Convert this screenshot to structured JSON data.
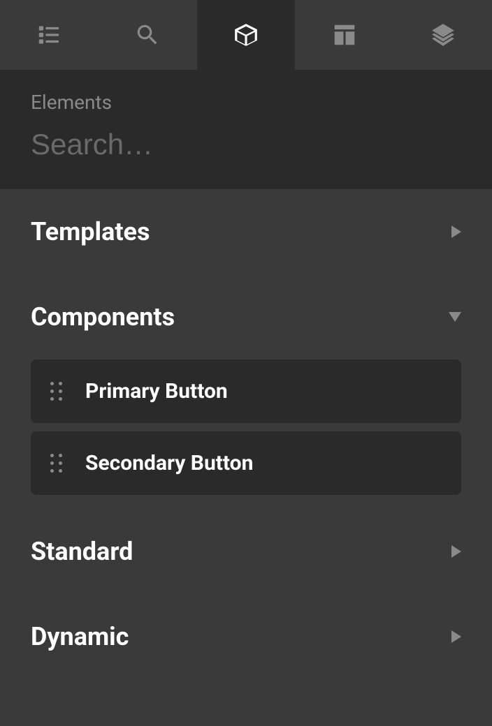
{
  "header": {
    "title": "Elements",
    "search_placeholder": "Search…"
  },
  "tabs": [
    {
      "name": "list"
    },
    {
      "name": "search"
    },
    {
      "name": "cube"
    },
    {
      "name": "layout"
    },
    {
      "name": "layers"
    }
  ],
  "sections": [
    {
      "title": "Templates",
      "expanded": false,
      "items": []
    },
    {
      "title": "Components",
      "expanded": true,
      "items": [
        {
          "label": "Primary Button"
        },
        {
          "label": "Secondary Button"
        }
      ]
    },
    {
      "title": "Standard",
      "expanded": false,
      "items": []
    },
    {
      "title": "Dynamic",
      "expanded": false,
      "items": []
    }
  ]
}
